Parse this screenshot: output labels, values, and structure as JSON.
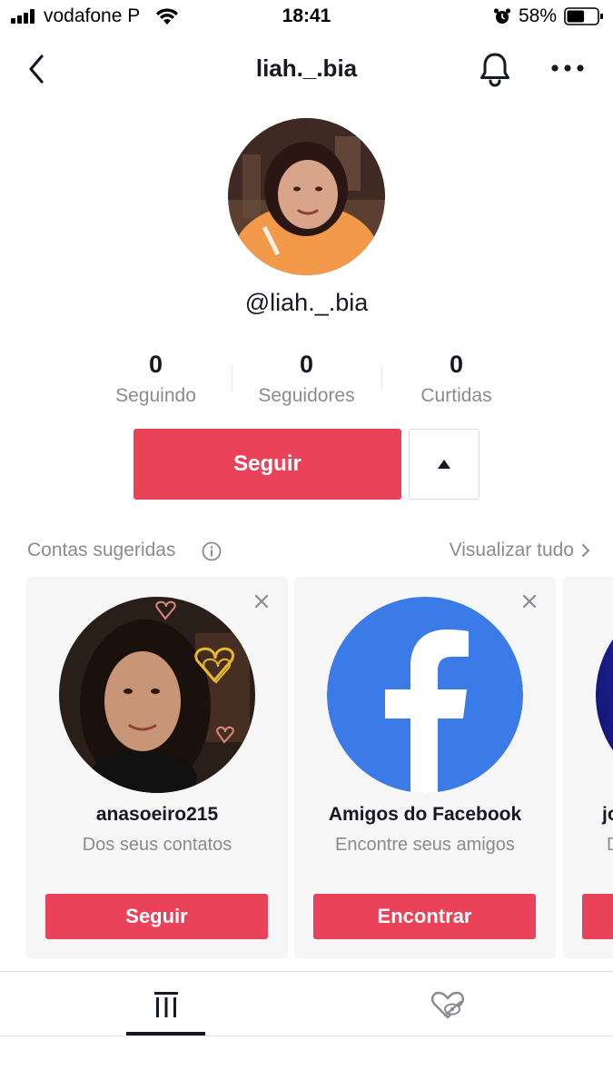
{
  "status_bar": {
    "carrier": "vodafone P",
    "time": "18:41",
    "battery_percent": "58%",
    "battery_level": 0.58,
    "icons": [
      "signal-icon",
      "wifi-icon",
      "alarm-icon",
      "battery-icon"
    ]
  },
  "header": {
    "title": "liah._.bia",
    "icons": [
      "back-arrow-icon",
      "bell-icon",
      "more-options-icon"
    ]
  },
  "profile": {
    "handle": "@liah._.bia",
    "stats": [
      {
        "value": "0",
        "label": "Seguindo"
      },
      {
        "value": "0",
        "label": "Seguidores"
      },
      {
        "value": "0",
        "label": "Curtidas"
      }
    ],
    "follow_label": "Seguir"
  },
  "suggested": {
    "title": "Contas sugeridas",
    "see_all": "Visualizar tudo",
    "cards": [
      {
        "name": "anasoeiro215",
        "subtitle": "Dos seus contatos",
        "button": "Seguir"
      },
      {
        "name": "Amigos do Facebook",
        "subtitle": "Encontre seus amigos",
        "button": "Encontrar"
      },
      {
        "name": "jo",
        "subtitle": "D"
      }
    ]
  },
  "tabs": {
    "items": [
      "videos-grid-icon",
      "liked-hidden-icon"
    ],
    "active": 0
  },
  "colors": {
    "accent": "#ea4359",
    "text": "#161823",
    "muted": "#8a8b91",
    "facebook": "#3b7be8"
  }
}
